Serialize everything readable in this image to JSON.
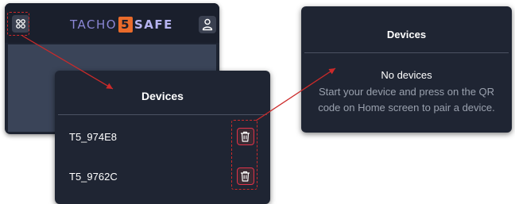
{
  "app": {
    "logo_prefix": "TACHO",
    "logo_number": "5",
    "logo_suffix": "SAFE"
  },
  "icons": {
    "menu": "grid-icon",
    "user": "user-icon",
    "delete": "trash-icon"
  },
  "devices_panel": {
    "title": "Devices",
    "items": [
      {
        "label": "T5_974E8"
      },
      {
        "label": "T5_9762C"
      }
    ]
  },
  "empty_panel": {
    "title": "Devices",
    "heading": "No devices",
    "message_line1": "Start your device and press on the QR",
    "message_line2": "code on Home screen to pair a device."
  },
  "colors": {
    "panel_bg": "#1f2533",
    "accent_red": "#e0334a",
    "annotation_red": "#cc2a2a",
    "logo_orange": "#e96b2b",
    "logo_purple": "#8a86d4"
  }
}
